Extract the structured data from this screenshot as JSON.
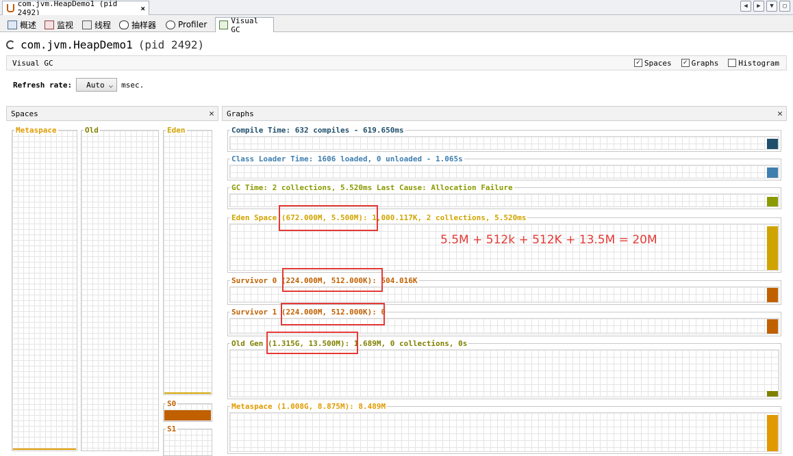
{
  "window": {
    "doc_tab_title": "com.jvm.HeapDemo1 (pid 2492)",
    "close_glyph": "×"
  },
  "subtabs": [
    {
      "label": "概述",
      "icon": "overview-icon"
    },
    {
      "label": "监视",
      "icon": "monitor-icon"
    },
    {
      "label": "线程",
      "icon": "threads-icon"
    },
    {
      "label": "抽样器",
      "icon": "sampler-icon"
    },
    {
      "label": "Profiler",
      "icon": "profiler-icon"
    },
    {
      "label": "Visual GC",
      "icon": "visualgc-icon"
    }
  ],
  "header": {
    "app_name": "com.jvm.HeapDemo1",
    "pid": "(pid 2492)"
  },
  "vgc_bar": {
    "title": "Visual GC",
    "spaces_label": "Spaces",
    "spaces_checked": true,
    "graphs_label": "Graphs",
    "graphs_checked": true,
    "histogram_label": "Histogram",
    "histogram_checked": false
  },
  "refresh": {
    "label": "Refresh rate:",
    "value": "Auto",
    "unit": "msec."
  },
  "spaces_panel": {
    "title": "Spaces",
    "columns": [
      {
        "name": "Metaspace",
        "color": "#e09a00",
        "fill_ratio": 0.005
      },
      {
        "name": "Old",
        "color": "#808000",
        "fill_ratio": 0.0
      },
      {
        "name": "Eden",
        "color": "#d0a400",
        "fill_ratio": 0.004
      },
      {
        "name": "S0",
        "color": "#c06000",
        "fill_ratio": 1.0
      },
      {
        "name": "S1",
        "color": "#c06000",
        "fill_ratio": 0.0
      }
    ]
  },
  "graphs_panel": {
    "title": "Graphs",
    "rows": [
      {
        "label": "Compile Time: 632 compiles - 619.650ms",
        "color": "#1f4f6b",
        "level": 0.85
      },
      {
        "label": "Class Loader Time: 1606 loaded, 0 unloaded - 1.065s",
        "color": "#3f7fb0",
        "level": 0.85
      },
      {
        "label": "GC Time: 2 collections, 5.520ms Last Cause: Allocation Failure",
        "color": "#8a9a00",
        "level": 0.8
      },
      {
        "label": "Eden Space (672.000M, 5.500M): 1,000.117K, 2 collections, 5.520ms",
        "color": "#d0a400",
        "level": 0.95
      },
      {
        "label": "Survivor 0 (224.000M, 512.000K): 504.016K",
        "color": "#c06000",
        "level": 0.95
      },
      {
        "label": "Survivor 1 (224.000M, 512.000K): 0",
        "color": "#c06000",
        "level": 0.95
      },
      {
        "label": "Old Gen (1.315G, 13.500M): 1.689M, 0 collections, 0s",
        "color": "#808000",
        "level": 0.12
      },
      {
        "label": "Metaspace (1.008G, 8.875M): 8.489M",
        "color": "#e09a00",
        "level": 0.95
      }
    ]
  },
  "annotation": "5.5M + 512k + 512K + 13.5M = 20M"
}
